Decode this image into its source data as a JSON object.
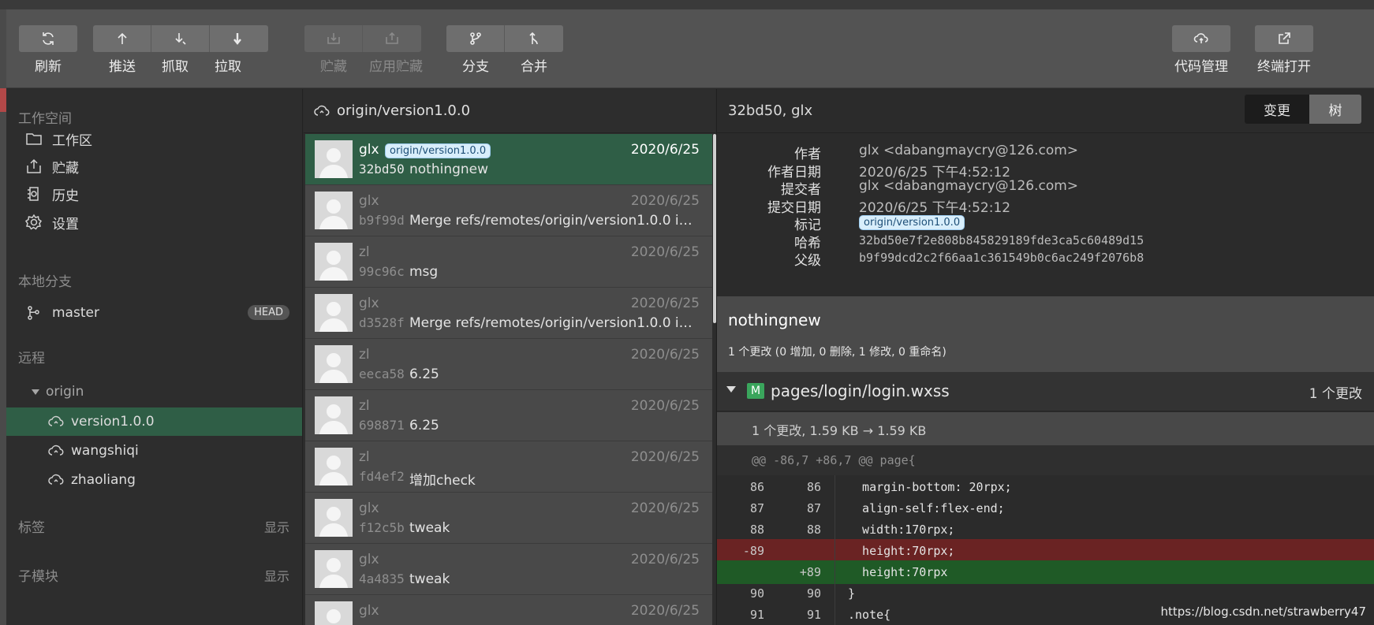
{
  "toolbar": {
    "refresh": "刷新",
    "push": "推送",
    "fetch": "抓取",
    "pull": "拉取",
    "stash": "贮藏",
    "apply_stash": "应用贮藏",
    "branch": "分支",
    "merge": "合并",
    "code_manage": "代码管理",
    "terminal": "终端打开"
  },
  "sidebar": {
    "workspace_title": "工作空间",
    "workspace_items": [
      {
        "label": "工作区",
        "icon": "folder-icon"
      },
      {
        "label": "贮藏",
        "icon": "stash-icon"
      },
      {
        "label": "历史",
        "icon": "history-icon"
      },
      {
        "label": "设置",
        "icon": "gear-icon"
      }
    ],
    "local_branch_title": "本地分支",
    "local_branch": {
      "label": "master",
      "badge": "HEAD"
    },
    "remote_title": "远程",
    "remote_name": "origin",
    "remote_branches": [
      "version1.0.0",
      "wangshiqi",
      "zhaoliang"
    ],
    "tags_title": "标签",
    "tags_show": "显示",
    "submodules_title": "子模块",
    "submodules_show": "显示"
  },
  "commit_list": {
    "header": "origin/version1.0.0",
    "commits": [
      {
        "author": "glx",
        "tag": "origin/version1.0.0",
        "date": "2020/6/25",
        "hash": "32bd50",
        "message": "nothingnew"
      },
      {
        "author": "glx",
        "tag": "",
        "date": "2020/6/25",
        "hash": "b9f99d",
        "message": "Merge refs/remotes/origin/version1.0.0 into ..."
      },
      {
        "author": "zl",
        "tag": "",
        "date": "2020/6/25",
        "hash": "99c96c",
        "message": "msg"
      },
      {
        "author": "glx",
        "tag": "",
        "date": "2020/6/25",
        "hash": "d3528f",
        "message": "Merge refs/remotes/origin/version1.0.0 into ..."
      },
      {
        "author": "zl",
        "tag": "",
        "date": "2020/6/25",
        "hash": "eeca58",
        "message": "6.25"
      },
      {
        "author": "zl",
        "tag": "",
        "date": "2020/6/25",
        "hash": "698871",
        "message": "6.25"
      },
      {
        "author": "zl",
        "tag": "",
        "date": "2020/6/25",
        "hash": "fd4ef2",
        "message": "增加check"
      },
      {
        "author": "glx",
        "tag": "",
        "date": "2020/6/25",
        "hash": "f12c5b",
        "message": "tweak"
      },
      {
        "author": "glx",
        "tag": "",
        "date": "2020/6/25",
        "hash": "4a4835",
        "message": "tweak"
      },
      {
        "author": "glx",
        "tag": "",
        "date": "2020/6/25",
        "hash": "",
        "message": ""
      }
    ]
  },
  "detail": {
    "header": "32bd50, glx",
    "seg_changes": "变更",
    "seg_tree": "树",
    "meta": [
      {
        "key": "作者",
        "value": "glx <dabangmaycry@126.com>"
      },
      {
        "key": "作者日期",
        "value": "2020/6/25 下午4:52:12"
      },
      {
        "key": "提交者",
        "value": "glx <dabangmaycry@126.com>"
      },
      {
        "key": "提交日期",
        "value": "2020/6/25 下午4:52:12"
      },
      {
        "key": "标记",
        "value": "origin/version1.0.0"
      },
      {
        "key": "哈希",
        "value": "32bd50e7f2e808b845829189fde3ca5c60489d15"
      },
      {
        "key": "父级",
        "value": "b9f99dcd2c2f66aa1c361549b0c6ac249f2076b8"
      }
    ],
    "message_title": "nothingnew",
    "message_stats": "1 个更改 (0 增加, 0 删除, 1 修改, 0 重命名)",
    "file": {
      "status": "M",
      "name": "pages/login/login.wxss",
      "count": "1 个更改",
      "size_change": "1 个更改, 1.59 KB  →  1.59 KB"
    },
    "hunk_header": "@@ -86,7 +86,7 @@ page{",
    "diff_lines": [
      {
        "old": "86",
        "new": "86",
        "code": "  margin-bottom: 20rpx;",
        "type": "ctx"
      },
      {
        "old": "87",
        "new": "87",
        "code": "  align-self:flex-end;",
        "type": "ctx"
      },
      {
        "old": "88",
        "new": "88",
        "code": "  width:170rpx;",
        "type": "ctx"
      },
      {
        "old": "-89",
        "new": "",
        "code": "  height:70rpx;",
        "type": "del"
      },
      {
        "old": "",
        "new": "+89",
        "code": "  height:70rpx",
        "type": "add"
      },
      {
        "old": "90",
        "new": "90",
        "code": "}",
        "type": "ctx"
      },
      {
        "old": "91",
        "new": "91",
        "code": ".note{",
        "type": "ctx"
      }
    ]
  },
  "watermark": "https://blog.csdn.net/strawberry47"
}
